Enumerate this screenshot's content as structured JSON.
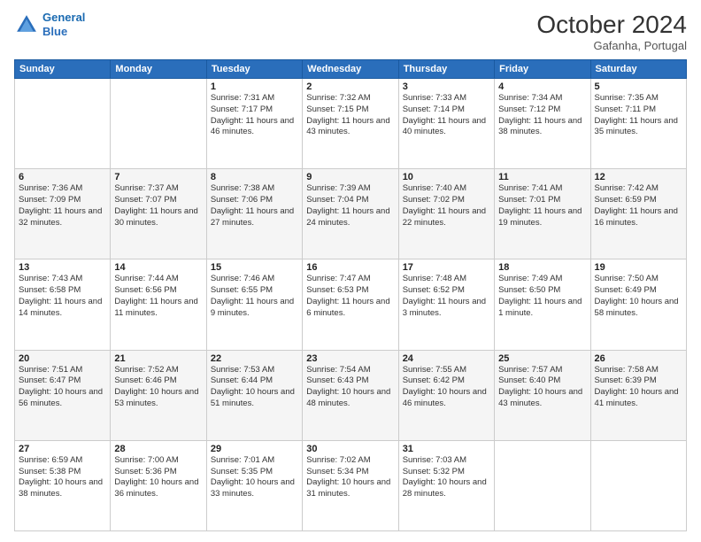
{
  "logo": {
    "line1": "General",
    "line2": "Blue"
  },
  "title": "October 2024",
  "location": "Gafanha, Portugal",
  "days_of_week": [
    "Sunday",
    "Monday",
    "Tuesday",
    "Wednesday",
    "Thursday",
    "Friday",
    "Saturday"
  ],
  "weeks": [
    [
      {
        "day": "",
        "sunrise": "",
        "sunset": "",
        "daylight": ""
      },
      {
        "day": "",
        "sunrise": "",
        "sunset": "",
        "daylight": ""
      },
      {
        "day": "1",
        "sunrise": "Sunrise: 7:31 AM",
        "sunset": "Sunset: 7:17 PM",
        "daylight": "Daylight: 11 hours and 46 minutes."
      },
      {
        "day": "2",
        "sunrise": "Sunrise: 7:32 AM",
        "sunset": "Sunset: 7:15 PM",
        "daylight": "Daylight: 11 hours and 43 minutes."
      },
      {
        "day": "3",
        "sunrise": "Sunrise: 7:33 AM",
        "sunset": "Sunset: 7:14 PM",
        "daylight": "Daylight: 11 hours and 40 minutes."
      },
      {
        "day": "4",
        "sunrise": "Sunrise: 7:34 AM",
        "sunset": "Sunset: 7:12 PM",
        "daylight": "Daylight: 11 hours and 38 minutes."
      },
      {
        "day": "5",
        "sunrise": "Sunrise: 7:35 AM",
        "sunset": "Sunset: 7:11 PM",
        "daylight": "Daylight: 11 hours and 35 minutes."
      }
    ],
    [
      {
        "day": "6",
        "sunrise": "Sunrise: 7:36 AM",
        "sunset": "Sunset: 7:09 PM",
        "daylight": "Daylight: 11 hours and 32 minutes."
      },
      {
        "day": "7",
        "sunrise": "Sunrise: 7:37 AM",
        "sunset": "Sunset: 7:07 PM",
        "daylight": "Daylight: 11 hours and 30 minutes."
      },
      {
        "day": "8",
        "sunrise": "Sunrise: 7:38 AM",
        "sunset": "Sunset: 7:06 PM",
        "daylight": "Daylight: 11 hours and 27 minutes."
      },
      {
        "day": "9",
        "sunrise": "Sunrise: 7:39 AM",
        "sunset": "Sunset: 7:04 PM",
        "daylight": "Daylight: 11 hours and 24 minutes."
      },
      {
        "day": "10",
        "sunrise": "Sunrise: 7:40 AM",
        "sunset": "Sunset: 7:02 PM",
        "daylight": "Daylight: 11 hours and 22 minutes."
      },
      {
        "day": "11",
        "sunrise": "Sunrise: 7:41 AM",
        "sunset": "Sunset: 7:01 PM",
        "daylight": "Daylight: 11 hours and 19 minutes."
      },
      {
        "day": "12",
        "sunrise": "Sunrise: 7:42 AM",
        "sunset": "Sunset: 6:59 PM",
        "daylight": "Daylight: 11 hours and 16 minutes."
      }
    ],
    [
      {
        "day": "13",
        "sunrise": "Sunrise: 7:43 AM",
        "sunset": "Sunset: 6:58 PM",
        "daylight": "Daylight: 11 hours and 14 minutes."
      },
      {
        "day": "14",
        "sunrise": "Sunrise: 7:44 AM",
        "sunset": "Sunset: 6:56 PM",
        "daylight": "Daylight: 11 hours and 11 minutes."
      },
      {
        "day": "15",
        "sunrise": "Sunrise: 7:46 AM",
        "sunset": "Sunset: 6:55 PM",
        "daylight": "Daylight: 11 hours and 9 minutes."
      },
      {
        "day": "16",
        "sunrise": "Sunrise: 7:47 AM",
        "sunset": "Sunset: 6:53 PM",
        "daylight": "Daylight: 11 hours and 6 minutes."
      },
      {
        "day": "17",
        "sunrise": "Sunrise: 7:48 AM",
        "sunset": "Sunset: 6:52 PM",
        "daylight": "Daylight: 11 hours and 3 minutes."
      },
      {
        "day": "18",
        "sunrise": "Sunrise: 7:49 AM",
        "sunset": "Sunset: 6:50 PM",
        "daylight": "Daylight: 11 hours and 1 minute."
      },
      {
        "day": "19",
        "sunrise": "Sunrise: 7:50 AM",
        "sunset": "Sunset: 6:49 PM",
        "daylight": "Daylight: 10 hours and 58 minutes."
      }
    ],
    [
      {
        "day": "20",
        "sunrise": "Sunrise: 7:51 AM",
        "sunset": "Sunset: 6:47 PM",
        "daylight": "Daylight: 10 hours and 56 minutes."
      },
      {
        "day": "21",
        "sunrise": "Sunrise: 7:52 AM",
        "sunset": "Sunset: 6:46 PM",
        "daylight": "Daylight: 10 hours and 53 minutes."
      },
      {
        "day": "22",
        "sunrise": "Sunrise: 7:53 AM",
        "sunset": "Sunset: 6:44 PM",
        "daylight": "Daylight: 10 hours and 51 minutes."
      },
      {
        "day": "23",
        "sunrise": "Sunrise: 7:54 AM",
        "sunset": "Sunset: 6:43 PM",
        "daylight": "Daylight: 10 hours and 48 minutes."
      },
      {
        "day": "24",
        "sunrise": "Sunrise: 7:55 AM",
        "sunset": "Sunset: 6:42 PM",
        "daylight": "Daylight: 10 hours and 46 minutes."
      },
      {
        "day": "25",
        "sunrise": "Sunrise: 7:57 AM",
        "sunset": "Sunset: 6:40 PM",
        "daylight": "Daylight: 10 hours and 43 minutes."
      },
      {
        "day": "26",
        "sunrise": "Sunrise: 7:58 AM",
        "sunset": "Sunset: 6:39 PM",
        "daylight": "Daylight: 10 hours and 41 minutes."
      }
    ],
    [
      {
        "day": "27",
        "sunrise": "Sunrise: 6:59 AM",
        "sunset": "Sunset: 5:38 PM",
        "daylight": "Daylight: 10 hours and 38 minutes."
      },
      {
        "day": "28",
        "sunrise": "Sunrise: 7:00 AM",
        "sunset": "Sunset: 5:36 PM",
        "daylight": "Daylight: 10 hours and 36 minutes."
      },
      {
        "day": "29",
        "sunrise": "Sunrise: 7:01 AM",
        "sunset": "Sunset: 5:35 PM",
        "daylight": "Daylight: 10 hours and 33 minutes."
      },
      {
        "day": "30",
        "sunrise": "Sunrise: 7:02 AM",
        "sunset": "Sunset: 5:34 PM",
        "daylight": "Daylight: 10 hours and 31 minutes."
      },
      {
        "day": "31",
        "sunrise": "Sunrise: 7:03 AM",
        "sunset": "Sunset: 5:32 PM",
        "daylight": "Daylight: 10 hours and 28 minutes."
      },
      {
        "day": "",
        "sunrise": "",
        "sunset": "",
        "daylight": ""
      },
      {
        "day": "",
        "sunrise": "",
        "sunset": "",
        "daylight": ""
      }
    ]
  ]
}
